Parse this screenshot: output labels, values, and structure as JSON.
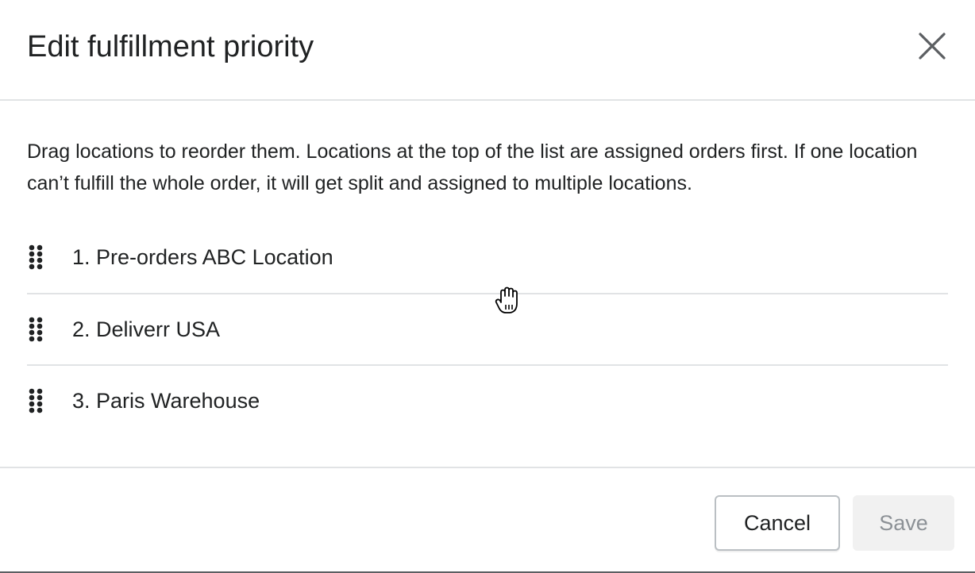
{
  "modal": {
    "title": "Edit fulfillment priority",
    "close_icon": "close-icon"
  },
  "body": {
    "description": "Drag locations to reorder them. Locations at the top of the list are assigned orders first. If one location can’t fulfill the whole order, it will get split and assigned to multiple locations.",
    "locations": [
      {
        "label": "1. Pre-orders ABC Location",
        "icon": "drag-handle-icon"
      },
      {
        "label": "2. Deliverr USA",
        "icon": "drag-handle-icon"
      },
      {
        "label": "3. Paris Warehouse",
        "icon": "drag-handle-icon"
      }
    ]
  },
  "footer": {
    "cancel_label": "Cancel",
    "save_label": "Save"
  },
  "cursor": {
    "icon": "grab-hand-cursor-icon"
  }
}
